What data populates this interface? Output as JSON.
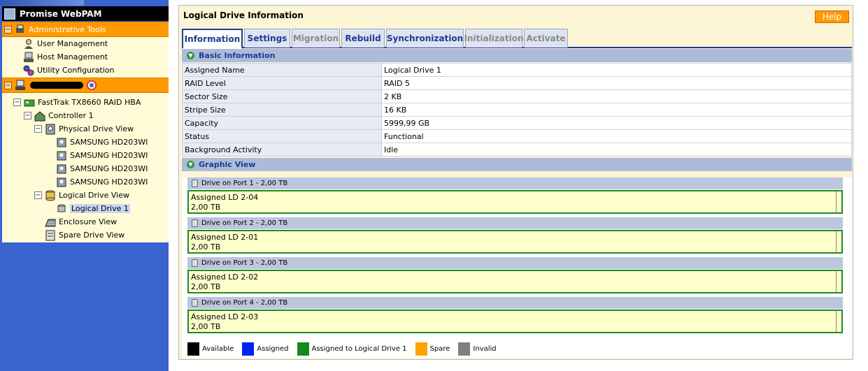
{
  "tree": {
    "app_title": "Promise WebPAM",
    "admin_tools": "Administrative Tools",
    "admin_items": [
      "User Management",
      "Host Management",
      "Utility Configuration"
    ],
    "hba": "FastTrak TX8660 RAID HBA",
    "controller": "Controller 1",
    "physical_drive_view": "Physical Drive View",
    "physical_drives": [
      "SAMSUNG HD203WI",
      "SAMSUNG HD203WI",
      "SAMSUNG HD203WI",
      "SAMSUNG HD203WI"
    ],
    "logical_drive_view": "Logical Drive View",
    "logical_drive": "Logical Drive 1",
    "enclosure_view": "Enclosure View",
    "spare_drive_view": "Spare Drive View"
  },
  "content": {
    "title": "Logical Drive Information",
    "help": "Help",
    "tabs": [
      {
        "label": "Information",
        "state": "active"
      },
      {
        "label": "Settings",
        "state": "enabled"
      },
      {
        "label": "Migration",
        "state": "disabled"
      },
      {
        "label": "Rebuild",
        "state": "enabled"
      },
      {
        "label": "Synchronization",
        "state": "enabled"
      },
      {
        "label": "Initialization",
        "state": "disabled"
      },
      {
        "label": "Activate",
        "state": "disabled"
      }
    ],
    "basic_info_header": "Basic Information",
    "basic_info": [
      {
        "key": "Assigned Name",
        "value": "Logical Drive 1"
      },
      {
        "key": "RAID Level",
        "value": "RAID 5"
      },
      {
        "key": "Sector Size",
        "value": "2 KB"
      },
      {
        "key": "Stripe Size",
        "value": "16 KB"
      },
      {
        "key": "Capacity",
        "value": "5999,99 GB"
      },
      {
        "key": "Status",
        "value": "Functional"
      },
      {
        "key": "Background Activity",
        "value": "Idle"
      }
    ],
    "graphic_header": "Graphic View",
    "drives": [
      {
        "header": "Drive on Port 1 - 2,00 TB",
        "assigned": "Assigned LD 2-04",
        "size": "2,00 TB"
      },
      {
        "header": "Drive on Port 2 - 2,00 TB",
        "assigned": "Assigned LD 2-01",
        "size": "2,00 TB"
      },
      {
        "header": "Drive on Port 3 - 2,00 TB",
        "assigned": "Assigned LD 2-02",
        "size": "2,00 TB"
      },
      {
        "header": "Drive on Port 4 - 2,00 TB",
        "assigned": "Assigned LD 2-03",
        "size": "2,00 TB"
      }
    ],
    "legend": [
      {
        "label": "Available",
        "color": "#000000"
      },
      {
        "label": "Assigned",
        "color": "#0022ee"
      },
      {
        "label": "Assigned to Logical Drive 1",
        "color": "#138a1c"
      },
      {
        "label": "Spare",
        "color": "#ffa200"
      },
      {
        "label": "Invalid",
        "color": "#808080"
      }
    ]
  }
}
